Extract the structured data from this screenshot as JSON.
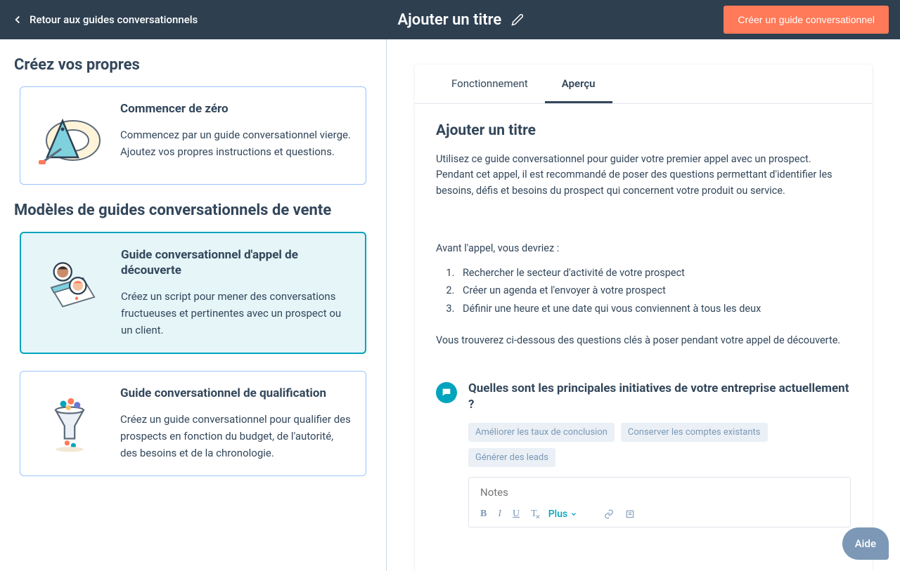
{
  "header": {
    "back": "Retour aux guides conversationnels",
    "title": "Ajouter un titre",
    "create": "Créer un guide conversationnel"
  },
  "left": {
    "section1": "Créez vos propres",
    "card1": {
      "title": "Commencer de zéro",
      "desc": "Commencez par un guide conversationnel vierge. Ajoutez vos propres instructions et questions."
    },
    "section2": "Modèles de guides conversationnels de vente",
    "card2": {
      "title": "Guide conversationnel d'appel de découverte",
      "desc": "Créez un script pour mener des conversations fructueuses et pertinentes avec un prospect ou un client."
    },
    "card3": {
      "title": "Guide conversationnel de qualification",
      "desc": "Créez un guide conversationnel pour qualifier des prospects en fonction du budget, de l'autorité, des besoins et de la chronologie."
    }
  },
  "preview": {
    "tabs": {
      "howItWorks": "Fonctionnement",
      "preview": "Aperçu"
    },
    "title": "Ajouter un titre",
    "intro": "Utilisez ce guide conversationnel pour guider votre premier appel avec un prospect. Pendant cet appel, il est recommandé de poser des questions permettant d'identifier les besoins, défis et besoins du prospect qui concernent votre produit ou service.",
    "beforeCall": "Avant l'appel, vous devriez :",
    "steps": [
      "Rechercher le secteur d'activité de votre prospect",
      "Créer un agenda et l'envoyer à votre prospect",
      "Définir une heure et une date qui vous conviennent à tous les deux"
    ],
    "below": "Vous trouverez ci-dessous des questions clés à poser pendant votre appel de découverte.",
    "question1": {
      "text": "Quelles sont les principales initiatives de votre entreprise actuellement ?",
      "tags": [
        "Améliorer les taux de conclusion",
        "Conserver les comptes existants",
        "Générer des leads"
      ],
      "notesPlaceholder": "Notes",
      "plus": "Plus"
    }
  },
  "help": "Aide"
}
